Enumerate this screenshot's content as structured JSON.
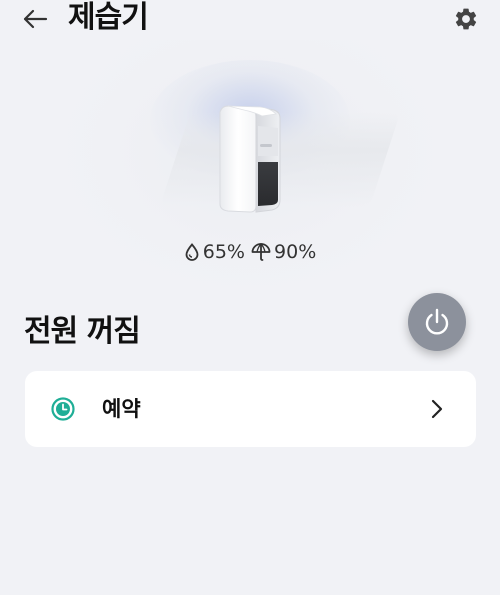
{
  "header": {
    "title": "제습기",
    "back_icon": "arrow-left-icon",
    "settings_icon": "gear-icon"
  },
  "device": {
    "image": "dehumidifier-illustration",
    "humidity_icon": "water-drop-icon",
    "humidity": "65%",
    "target_icon": "umbrella-icon",
    "target_humidity": "90%"
  },
  "power": {
    "status": "전원 꺼짐",
    "button_icon": "power-icon",
    "button_color": "#8c919c"
  },
  "schedule": {
    "label": "예약",
    "icon": "clock-icon",
    "icon_color": "#1fae96",
    "chevron_icon": "chevron-right-icon"
  },
  "colors": {
    "background": "#f1f2f6",
    "card": "#ffffff"
  }
}
